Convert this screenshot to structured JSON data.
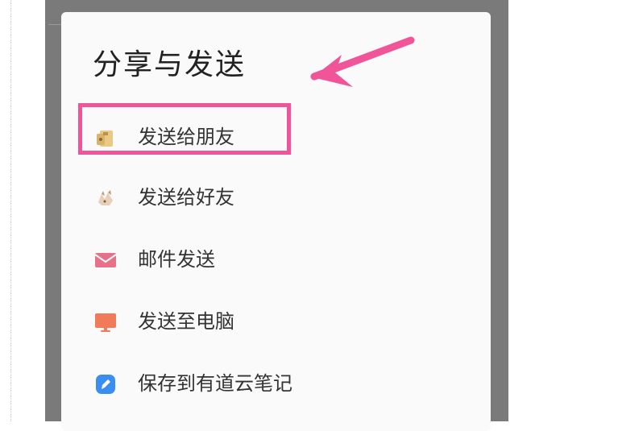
{
  "dialog": {
    "title": "分享与发送",
    "items": [
      {
        "label": "发送给朋友",
        "icon": "wechat-friend-icon"
      },
      {
        "label": "发送给好友",
        "icon": "qq-friend-icon"
      },
      {
        "label": "邮件发送",
        "icon": "mail-icon",
        "color": "#e8718a"
      },
      {
        "label": "发送至电脑",
        "icon": "monitor-icon",
        "color": "#f07a5a"
      },
      {
        "label": "保存到有道云笔记",
        "icon": "youdao-note-icon",
        "color": "#3a8ef0"
      }
    ]
  },
  "annotation": {
    "color": "#f0559a",
    "icon": "arrow-icon"
  }
}
